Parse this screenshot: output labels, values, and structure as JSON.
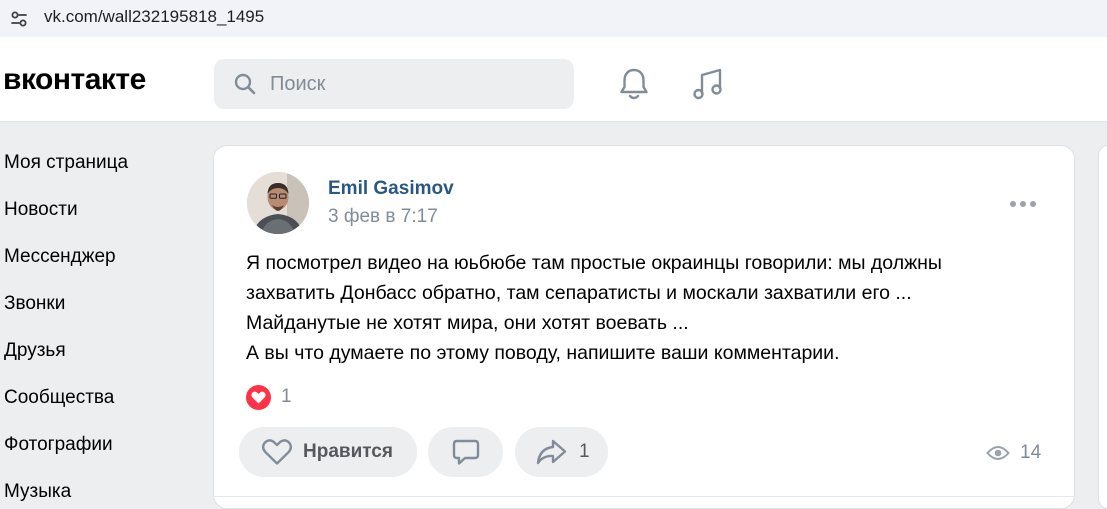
{
  "browser": {
    "url": "vk.com/wall232195818_1495",
    "site_info_icon": "tune-icon"
  },
  "header": {
    "logo": "вконтакте",
    "search_placeholder": "Поиск",
    "icons": [
      "search-icon",
      "bell-icon",
      "music-note-icon"
    ]
  },
  "sidebar": {
    "items": [
      {
        "label": "Моя страница"
      },
      {
        "label": "Новости"
      },
      {
        "label": "Мессенджер"
      },
      {
        "label": "Звонки"
      },
      {
        "label": "Друзья"
      },
      {
        "label": "Сообщества"
      },
      {
        "label": "Фотографии"
      },
      {
        "label": "Музыка"
      }
    ]
  },
  "post": {
    "author": "Emil Gasimov",
    "date": "3 фев в 7:17",
    "text_lines": [
      "Я посмотрел видео на юьбюбе там простые окраинцы говорили: мы должны",
      "захватить Донбасс обратно, там сепаратисты и москали захватили его ...",
      "Майданутые не хотят мира, они хотят воевать ...",
      "А вы что думаете по этому поводу, напишите ваши комментарии."
    ],
    "reactions_count": "1",
    "like_label": "Нравится",
    "share_count": "1",
    "views_count": "14",
    "colors": {
      "accent": "#2a5885",
      "reaction_red": "#ff3347",
      "secondary": "#818c99"
    }
  }
}
